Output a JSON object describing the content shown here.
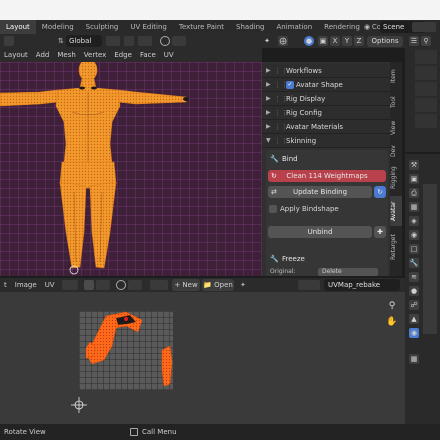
{
  "workspace_tabs": [
    "Layout",
    "Modeling",
    "Sculpting",
    "UV Editing",
    "Texture Paint",
    "Shading",
    "Animation",
    "Rendering",
    "Compositing"
  ],
  "scene_name": "Scene",
  "viewport_header": {
    "orientation": "Global",
    "options_label": "Options"
  },
  "viewport_menu": [
    "Layout",
    "Add",
    "Mesh",
    "Vertex",
    "Edge",
    "Face",
    "UV"
  ],
  "npanel": {
    "sections": [
      "Workflows",
      "Avatar Shape",
      "Rig Display",
      "Rig Config",
      "Avatar Materials",
      "Skinning"
    ],
    "bind_title": "Bind",
    "clean_button": "Clean 114 Weightmaps",
    "update_button": "Update Binding",
    "apply_bindshape": "Apply Bindshape",
    "unbind_button": "Unbind",
    "freeze_title": "Freeze",
    "original_label": "Original:",
    "original_value": "Delete",
    "vertical_tabs": [
      "Item",
      "Tool",
      "View",
      "Dev",
      "Rigging",
      "Avatar",
      "Retarget"
    ]
  },
  "uv_editor": {
    "menu": [
      "t",
      "Image",
      "UV"
    ],
    "new_label": "New",
    "open_label": "Open",
    "uvmap_name": "UVMap_rebake"
  },
  "statusbar": {
    "left": "Rotate View",
    "right": "Call Menu"
  },
  "colors": {
    "accent_orange": "#f08a24",
    "clean_button_red": "#b8414b",
    "selected_blue": "#4b7bd1"
  }
}
